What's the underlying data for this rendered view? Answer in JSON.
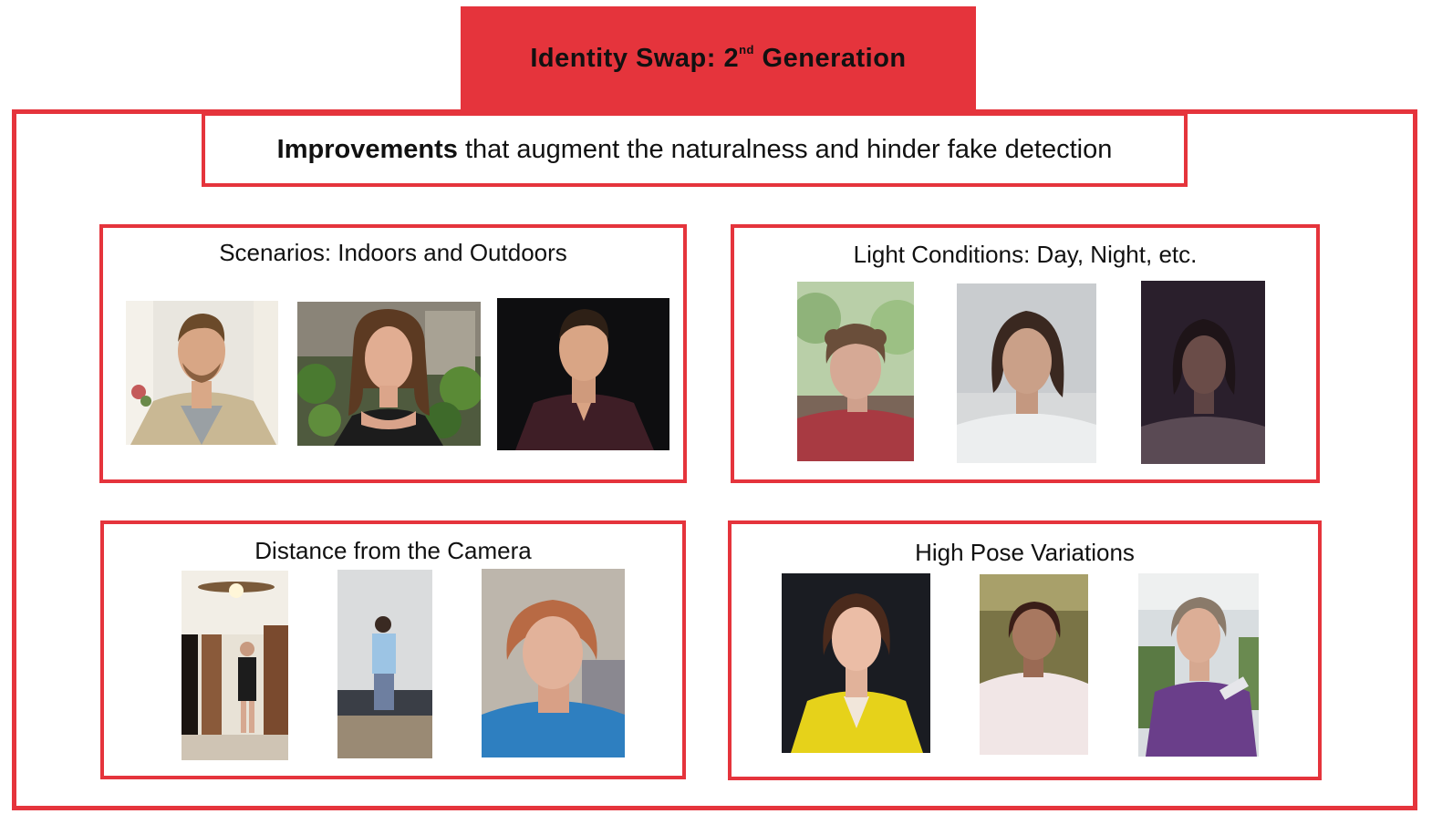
{
  "header": {
    "title_pre": "Identity Swap: 2",
    "title_sup": "nd",
    "title_post": " Generation"
  },
  "subtitle": {
    "bold": "Improvements",
    "rest": " that augment the naturalness and hinder fake detection"
  },
  "panels": {
    "scenarios": {
      "title": "Scenarios: Indoors and Outdoors"
    },
    "light": {
      "title": "Light Conditions: Day, Night, etc."
    },
    "distance": {
      "title": "Distance from the Camera"
    },
    "pose": {
      "title": "High Pose Variations"
    }
  },
  "colors": {
    "accent": "#e5343c"
  }
}
